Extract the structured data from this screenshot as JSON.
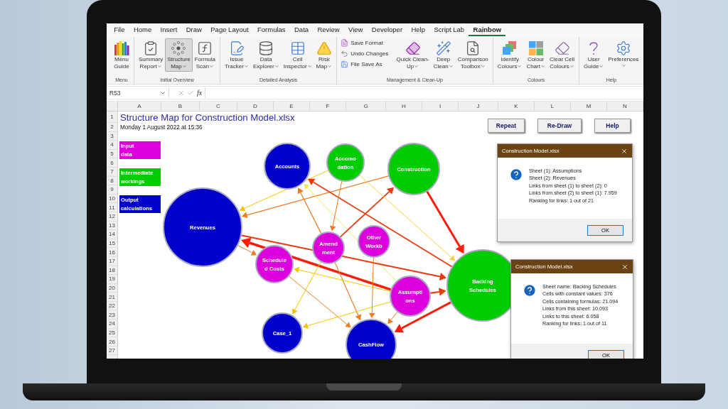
{
  "ribbon_tabs": [
    {
      "label": "File",
      "selected": false
    },
    {
      "label": "Home",
      "selected": false
    },
    {
      "label": "Insert",
      "selected": false
    },
    {
      "label": "Draw",
      "selected": false
    },
    {
      "label": "Page Layout",
      "selected": false
    },
    {
      "label": "Formulas",
      "selected": false
    },
    {
      "label": "Data",
      "selected": false
    },
    {
      "label": "Review",
      "selected": false
    },
    {
      "label": "View",
      "selected": false
    },
    {
      "label": "Developer",
      "selected": false
    },
    {
      "label": "Help",
      "selected": false
    },
    {
      "label": "Script Lab",
      "selected": false
    },
    {
      "label": "Rainbow",
      "selected": true
    }
  ],
  "ribbon_groups": [
    {
      "label": "Menu",
      "buttons": [
        {
          "kind": "large",
          "lines": [
            "Menu",
            "Guide"
          ],
          "dropdown": false,
          "highlighted": false
        }
      ]
    },
    {
      "label": "Initial Overview",
      "buttons": [
        {
          "kind": "large",
          "lines": [
            "Summary",
            "Report"
          ],
          "dropdown": true,
          "highlighted": false
        },
        {
          "kind": "large",
          "lines": [
            "Structure",
            "Map"
          ],
          "dropdown": true,
          "highlighted": true
        },
        {
          "kind": "large",
          "lines": [
            "Formula",
            "Scan"
          ],
          "dropdown": true,
          "highlighted": false
        }
      ]
    },
    {
      "label": "Detailed Analysis",
      "buttons": [
        {
          "kind": "large",
          "lines": [
            "Issue",
            "Tracker"
          ],
          "dropdown": true,
          "highlighted": false
        },
        {
          "kind": "large",
          "lines": [
            "Data",
            "Explorer"
          ],
          "dropdown": true,
          "highlighted": false
        },
        {
          "kind": "large",
          "lines": [
            "Cell",
            "Inspector"
          ],
          "dropdown": true,
          "highlighted": false
        },
        {
          "kind": "large",
          "lines": [
            "Risk",
            "Map"
          ],
          "dropdown": true,
          "highlighted": false
        }
      ]
    },
    {
      "label": "Management & Clean-Up",
      "buttons": [
        {
          "kind": "small",
          "lines": [
            "Save Format"
          ]
        },
        {
          "kind": "small",
          "lines": [
            "Undo Changes"
          ]
        },
        {
          "kind": "small",
          "lines": [
            "File Save As"
          ]
        },
        {
          "kind": "large",
          "lines": [
            "Quick Clean-",
            "Up"
          ],
          "dropdown": true,
          "highlighted": false
        },
        {
          "kind": "large",
          "lines": [
            "Deep",
            "Clean"
          ],
          "dropdown": true,
          "highlighted": false
        },
        {
          "kind": "large",
          "lines": [
            "Comparison",
            "Toolbox"
          ],
          "dropdown": true,
          "highlighted": false
        }
      ]
    },
    {
      "label": "Colours",
      "buttons": [
        {
          "kind": "large",
          "lines": [
            "Identify",
            "Colours"
          ],
          "dropdown": true,
          "highlighted": false
        },
        {
          "kind": "large",
          "lines": [
            "Colour",
            "Chart"
          ],
          "dropdown": true,
          "highlighted": false
        },
        {
          "kind": "large",
          "lines": [
            "Clear Cell",
            "Colours"
          ],
          "dropdown": true,
          "highlighted": false
        }
      ]
    },
    {
      "label": "Help",
      "buttons": [
        {
          "kind": "large",
          "lines": [
            "User",
            "Guide"
          ],
          "dropdown": true,
          "highlighted": false
        },
        {
          "kind": "large",
          "lines": [
            "Preferences"
          ],
          "dropdown": true,
          "highlighted": false
        }
      ]
    }
  ],
  "formula_bar": {
    "name_box": "R53",
    "function_label": "fx"
  },
  "columns": [
    "A",
    "B",
    "C",
    "D",
    "E",
    "F",
    "G",
    "H",
    "I",
    "J",
    "K",
    "L",
    "M",
    "N"
  ],
  "rows": [
    "1",
    "2",
    "3",
    "4",
    "5",
    "6",
    "7",
    "8",
    "9",
    "10",
    "11",
    "12",
    "13",
    "14",
    "15",
    "16",
    "17",
    "18",
    "19",
    "20",
    "21",
    "22",
    "23",
    "24",
    "25",
    "26",
    "27"
  ],
  "sheet": {
    "title": "Structure Map for Construction Model.xlsx",
    "subtitle": "Monday 1 August 2022 at 15:36",
    "legend": [
      {
        "lines": [
          "Input",
          "data"
        ],
        "color": "#dd00dd"
      },
      {
        "lines": [
          "Intermediate",
          "workings"
        ],
        "color": "#00cc00"
      },
      {
        "lines": [
          "Output",
          "calculations"
        ],
        "color": "#0000cc"
      }
    ],
    "buttons": [
      "Repeat",
      "Re-Draw",
      "Help"
    ]
  },
  "structure_map": {
    "nodes": [
      {
        "lines": [
          "Accounts"
        ],
        "color": "#0000cc"
      },
      {
        "lines": [
          "Accomo",
          "dation"
        ],
        "color": "#00cc00"
      },
      {
        "lines": [
          "Construction"
        ],
        "color": "#00cc00"
      },
      {
        "lines": [
          "Revenues"
        ],
        "color": "#0000cc"
      },
      {
        "lines": [
          "Amend",
          "ment"
        ],
        "color": "#dd00dd"
      },
      {
        "lines": [
          "Other",
          "Workb"
        ],
        "color": "#dd00dd"
      },
      {
        "lines": [
          "Schedule",
          "d Costs"
        ],
        "color": "#dd00dd"
      },
      {
        "lines": [
          "Assumpti",
          "ons"
        ],
        "color": "#dd00dd"
      },
      {
        "lines": [
          "Backing",
          "Schedules"
        ],
        "color": "#00cc00"
      },
      {
        "lines": [
          "Case_1"
        ],
        "color": "#0000cc"
      },
      {
        "lines": [
          "CashFlow"
        ],
        "color": "#0000cc"
      }
    ]
  },
  "dialogs": [
    {
      "title": "Construction Model.xlsx",
      "lines": [
        "Sheet (1): Assumptions",
        "Sheet (2): Revenues",
        "Links from sheet (1) to sheet (2): 0",
        "Links from sheet (2) to sheet (1): 7.959",
        "Ranking for links: 1 out of 21"
      ],
      "button": "OK"
    },
    {
      "title": "Construction Model.xlsx",
      "lines": [
        "Sheet name: Backing Schedules",
        "Cells with constant values: 376",
        "Cells containing formulas: 21.094",
        "Links from this sheet: 10.093",
        "Links to this sheet: 6.058",
        "Ranking for links: 1 out of 11"
      ],
      "button": "OK"
    }
  ]
}
